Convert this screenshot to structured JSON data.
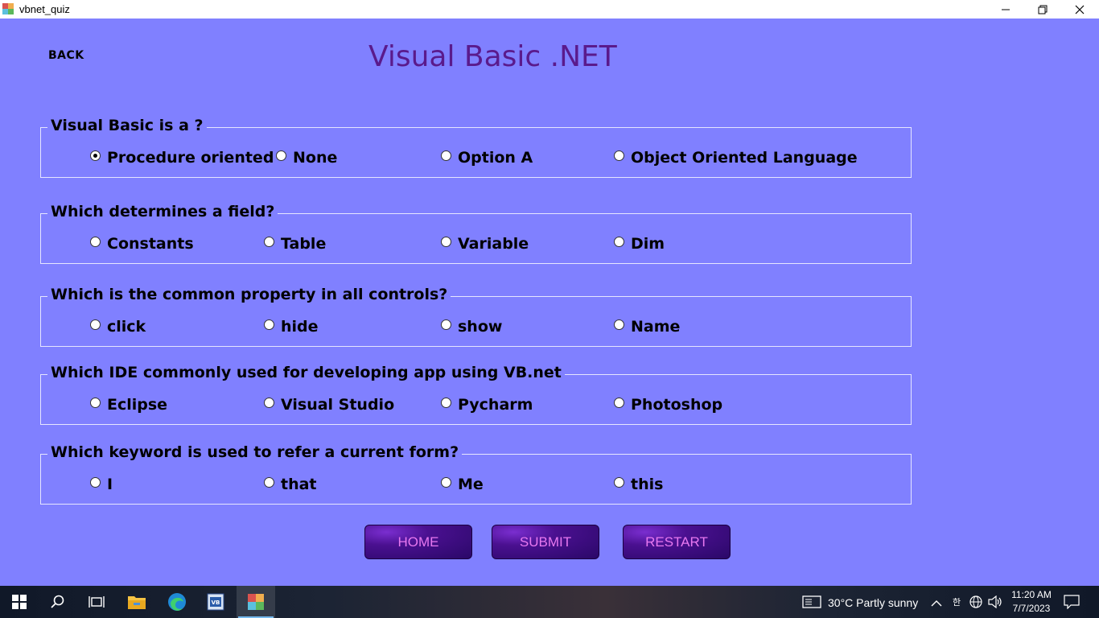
{
  "window": {
    "title": "vbnet_quiz"
  },
  "header": {
    "back_label": "BACK",
    "title": "Visual Basic .NET"
  },
  "questions": [
    {
      "text": "Visual Basic is a ?",
      "options": [
        "Procedure oriented",
        "None",
        "Option A",
        "Object Oriented Language"
      ],
      "selected": 0
    },
    {
      "text": "Which determines a field?",
      "options": [
        "Constants",
        "Table",
        "Variable",
        "Dim"
      ],
      "selected": null
    },
    {
      "text": "Which is the common property in all controls?",
      "options": [
        "click",
        "hide",
        "show",
        "Name"
      ],
      "selected": null
    },
    {
      "text": "Which IDE commonly used for developing app using VB.net",
      "options": [
        "Eclipse",
        "Visual Studio",
        "Pycharm",
        "Photoshop"
      ],
      "selected": null
    },
    {
      "text": "Which keyword is used to refer a current form?",
      "options": [
        "I",
        "that",
        "Me",
        "this"
      ],
      "selected": null
    }
  ],
  "buttons": {
    "home": "HOME",
    "submit": "SUBMIT",
    "restart": "RESTART"
  },
  "taskbar": {
    "weather": "30°C  Partly sunny",
    "time": "11:20 AM",
    "date": "7/7/2023",
    "icons": [
      "windows-start-icon",
      "search-icon",
      "task-view-icon",
      "file-explorer-icon",
      "edge-icon",
      "visual-basic-icon",
      "vbnet-quiz-app-icon"
    ]
  },
  "colors": {
    "background": "#8080ff",
    "title": "#5a1a8c",
    "button_text": "#e878f0",
    "button_bg": "#3a0c80"
  }
}
